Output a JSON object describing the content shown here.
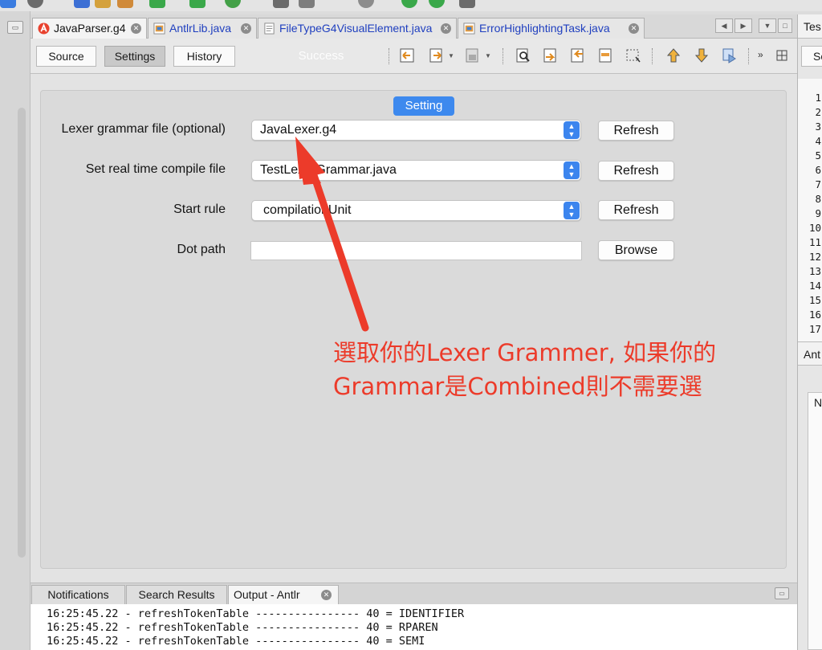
{
  "colors": {
    "accent": "#3d89ee",
    "annotation": "#ec3b2a"
  },
  "tabs": [
    {
      "label": "JavaParser.g4",
      "icon": "antlr-icon",
      "active": true
    },
    {
      "label": "AntlrLib.java",
      "icon": "java-file-icon",
      "active": false
    },
    {
      "label": "FileTypeG4VisualElement.java",
      "icon": "java-file-icon",
      "active": false
    },
    {
      "label": "ErrorHighlightingTask.java",
      "icon": "java-file-icon",
      "active": false
    }
  ],
  "toolbar": {
    "source": "Source",
    "settings": "Settings",
    "history": "History",
    "status": "Success"
  },
  "panel": {
    "title": "Setting",
    "rows": [
      {
        "label": "Lexer grammar file (optional)",
        "value": "JavaLexer.g4",
        "button": "Refresh"
      },
      {
        "label": "Set real time compile file",
        "value": "TestLexerGrammar.java",
        "button": "Refresh"
      },
      {
        "label": "Start rule",
        "value": "compilationUnit",
        "button": "Refresh"
      },
      {
        "label": "Dot path",
        "value": "",
        "button": "Browse"
      }
    ]
  },
  "annotation": {
    "text": "選取你的Lexer Grammer, 如果你的Grammar是Combined則不需要選"
  },
  "output": {
    "tabs": [
      "Notifications",
      "Search Results",
      "Output - Antlr"
    ],
    "lines": [
      "16:25:45.22 - refreshTokenTable ---------------- 40 = IDENTIFIER",
      "16:25:45.22 - refreshTokenTable ---------------- 40 = RPAREN",
      "16:25:45.22 - refreshTokenTable ---------------- 40 = SEMI"
    ]
  },
  "right_panel": {
    "tab": "Tes",
    "button": "So",
    "line_numbers": [
      "1",
      "2",
      "3",
      "4",
      "5",
      "6",
      "7",
      "8",
      "9",
      "10",
      "11",
      "12",
      "13",
      "14",
      "15",
      "16",
      "17"
    ],
    "tab2": "Ant",
    "box": "N"
  }
}
